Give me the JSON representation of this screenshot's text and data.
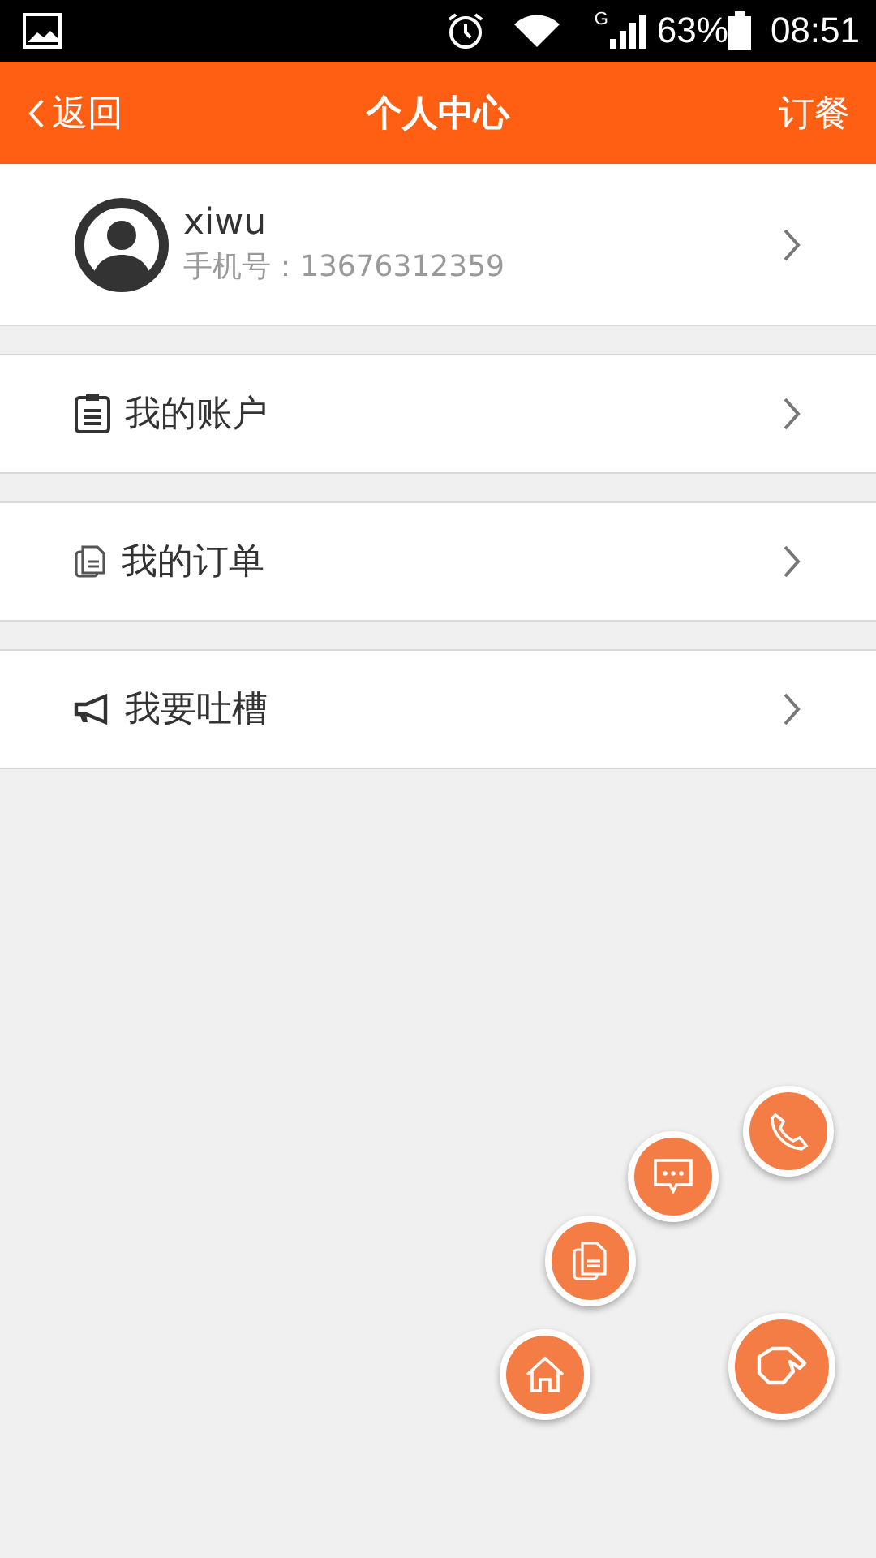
{
  "status_bar": {
    "network": "G",
    "battery": "63%",
    "time": "08:51"
  },
  "header": {
    "back": "返回",
    "title": "个人中心",
    "action": "订餐"
  },
  "profile": {
    "name": "xiwu",
    "phone": "手机号：13676312359"
  },
  "menu": [
    {
      "kind": "account",
      "label": "我的账户"
    },
    {
      "kind": "orders",
      "label": "我的订单"
    },
    {
      "kind": "feedback",
      "label": "我要吐槽"
    }
  ],
  "fab": [
    {
      "kind": "phone"
    },
    {
      "kind": "chat"
    },
    {
      "kind": "orders"
    },
    {
      "kind": "home"
    },
    {
      "kind": "main"
    }
  ]
}
